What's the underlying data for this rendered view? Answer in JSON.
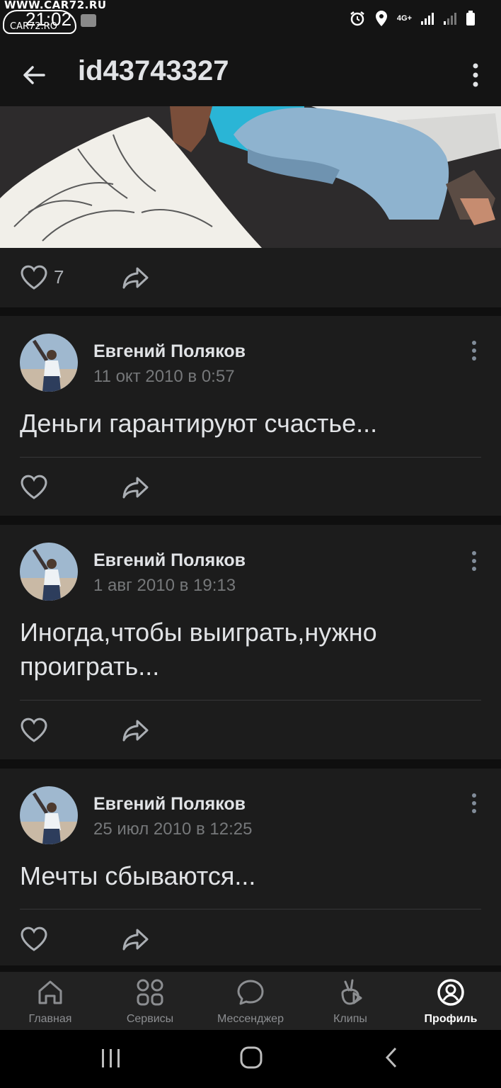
{
  "watermark": {
    "top": "WWW.CAR72.RU",
    "bottom": "CAR72.RO"
  },
  "status_bar": {
    "time": "21:02",
    "network": "4G+"
  },
  "header": {
    "title": "id43743327"
  },
  "photo_post": {
    "likes": "7"
  },
  "posts": [
    {
      "author": "Евгений Поляков",
      "date": "11 окт 2010 в 0:57",
      "text": "Деньги гарантируют счастье..."
    },
    {
      "author": "Евгений Поляков",
      "date": "1 авг 2010 в 19:13",
      "text": "Иногда,чтобы выиграть,нужно проиграть..."
    },
    {
      "author": "Евгений Поляков",
      "date": "25 июл 2010 в 12:25",
      "text": "Мечты сбываются..."
    }
  ],
  "bottom_nav": [
    {
      "label": "Главная",
      "icon": "home-icon"
    },
    {
      "label": "Сервисы",
      "icon": "services-icon"
    },
    {
      "label": "Мессенджер",
      "icon": "messenger-icon"
    },
    {
      "label": "Клипы",
      "icon": "clips-icon"
    },
    {
      "label": "Профиль",
      "icon": "profile-icon",
      "active": true
    }
  ],
  "colors": {
    "background": "#0f0f0f",
    "card": "#1c1c1c",
    "text": "#e1e3e6",
    "secondary": "#76787a"
  }
}
